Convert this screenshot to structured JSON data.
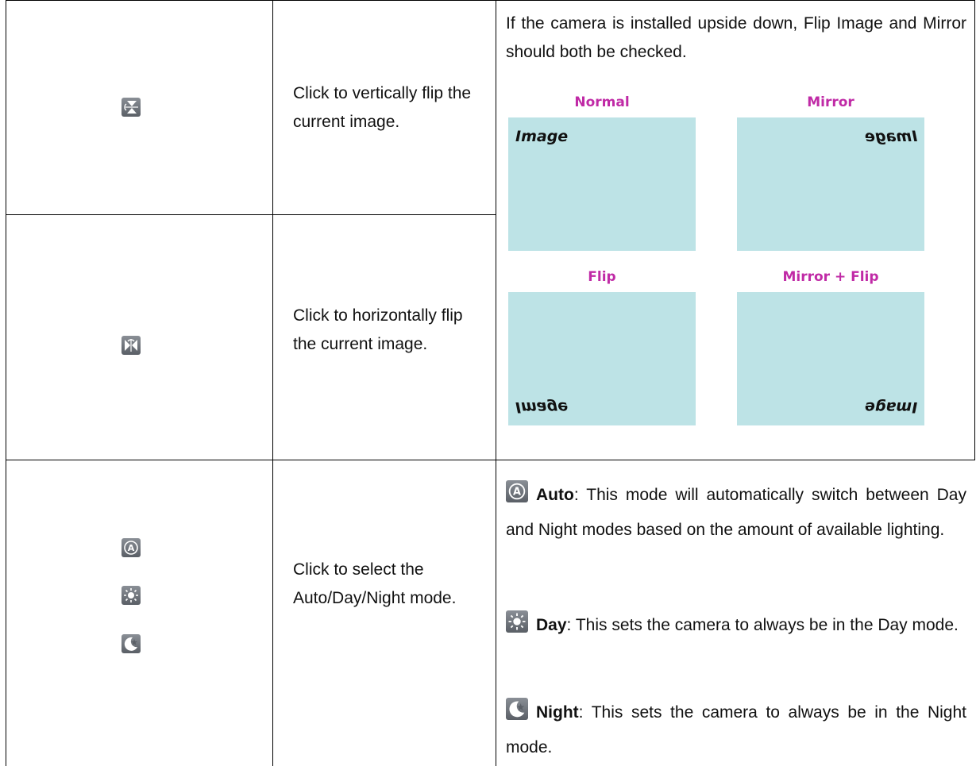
{
  "rows": [
    {
      "description": "Click to vertically flip the current image.",
      "icon": "vertical-flip-icon"
    },
    {
      "description": "Click to horizontally flip the current image.",
      "icon": "horizontal-flip-icon"
    },
    {
      "description": "Click to select the Auto/Day/Night mode.",
      "icons": [
        "auto-mode-icon",
        "day-mode-icon",
        "night-mode-icon"
      ]
    }
  ],
  "flip_note": "If the camera is installed upside down, Flip Image and Mirror should both be checked.",
  "examples": {
    "normal_label": "Normal",
    "mirror_label": "Mirror",
    "flip_label": "Flip",
    "mirror_flip_label": "Mirror + Flip",
    "image_word": "Image"
  },
  "modes": {
    "auto_name": "Auto",
    "auto_desc": ": This mode will automatically switch between Day and Night modes based on the amount of available lighting.",
    "day_name": "Day",
    "day_desc": ": This sets the camera to always be in the Day mode.",
    "night_name": "Night",
    "night_desc": ": This sets the camera to always be in the Night mode."
  },
  "colors": {
    "example_label": "#c02aa6",
    "example_box": "#bde3e6"
  }
}
